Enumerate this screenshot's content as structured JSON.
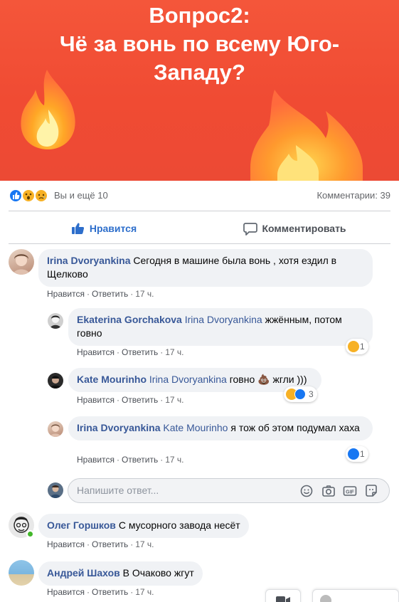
{
  "banner": {
    "title": "Вопрос2:\nЧё за вонь по всему Юго-\nЗападу?",
    "background": "#f04b33"
  },
  "reactions": {
    "icons": [
      "like-icon",
      "wow-icon",
      "sad-icon"
    ],
    "summary": "Вы и ещё 10",
    "comments_count": "Комментарии: 39"
  },
  "actions": {
    "like_label": "Нравится",
    "comment_label": "Комментировать"
  },
  "meta_labels": {
    "like": "Нравится",
    "reply": "Ответить",
    "dot": "·"
  },
  "comments": [
    {
      "author": "Irina Dvoryankina",
      "mention": "",
      "text": "Сегодня в машине была вонь , хотя ездил в Щелково",
      "time": "17 ч.",
      "replies": [
        {
          "author": "Ekaterina Gorchakova",
          "mention": "Irina Dvoryankina",
          "text": "жжённым, потом говно",
          "time": "17 ч.",
          "reaction_count": "1",
          "reaction_icons": [
            "wow-icon"
          ]
        },
        {
          "author": "Kate Mourinho",
          "mention": "Irina Dvoryankina",
          "text": "говно 💩 жгли )))",
          "time": "17 ч.",
          "reaction_count": "3",
          "reaction_icons": [
            "haha-icon",
            "like-icon"
          ]
        },
        {
          "author": "Irina Dvoryankina",
          "mention": "Kate Mourinho",
          "text": "я тож об этом подумал хаха",
          "time": "17 ч.",
          "reaction_count": "1",
          "reaction_icons": [
            "like-icon"
          ]
        }
      ]
    },
    {
      "author": "Олег Горшков",
      "mention": "",
      "text": "С мусорного завода несёт",
      "time": "17 ч.",
      "online": true
    },
    {
      "author": "Андрей Шахов",
      "mention": "",
      "text": "В Очаково жгут",
      "time": "17 ч."
    }
  ],
  "reply_box": {
    "placeholder": "Напишите ответ...",
    "tools": [
      "emoji-icon",
      "camera-icon",
      "gif-icon",
      "sticker-icon"
    ]
  },
  "colors": {
    "link_blue": "#385898",
    "like_blue": "#2d6ecb",
    "bubble_bg": "#f0f2f5",
    "meta_gray": "#65676b",
    "online_green": "#42b72a"
  }
}
